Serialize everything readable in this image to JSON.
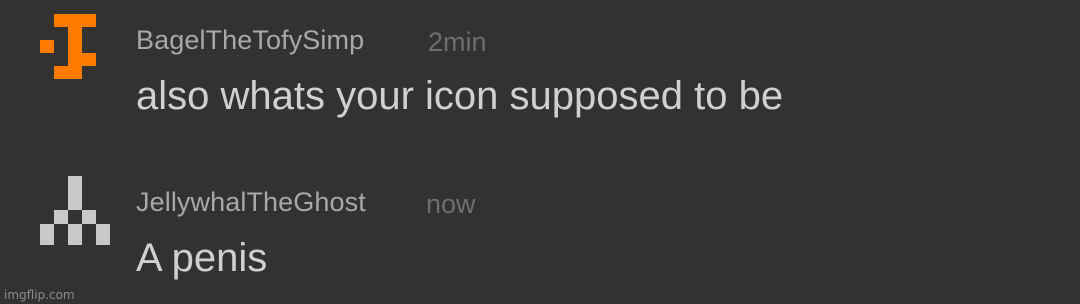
{
  "comments": [
    {
      "avatar_icon": "orange-pixel-cross-icon",
      "avatar_color": "#ff7a00",
      "username": "BagelTheTofySimp",
      "timestamp": "2min",
      "message": "also whats your icon supposed to be"
    },
    {
      "avatar_icon": "gray-pixel-stack-icon",
      "avatar_color": "#c8c8c8",
      "username": "JellywhalTheGhost",
      "timestamp": "now",
      "message": "A penis"
    }
  ],
  "watermark": "imgflip.com",
  "colors": {
    "background": "#323232",
    "username": "#a8a8a8",
    "timestamp": "#6e6e6e",
    "message": "#d0d0d0"
  }
}
